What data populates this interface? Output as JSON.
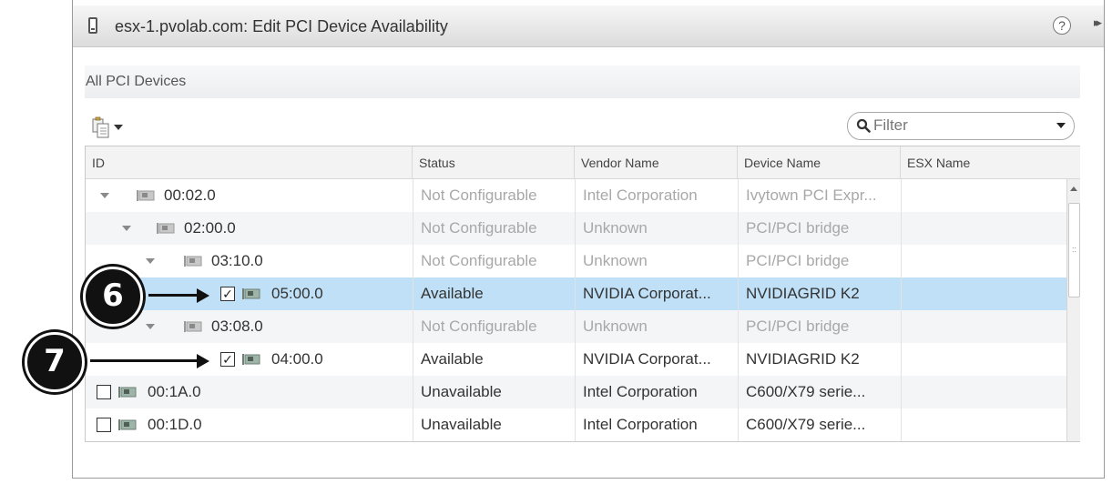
{
  "dialog": {
    "title": "esx-1.pvolab.com: Edit PCI Device Availability",
    "help_icon": "?",
    "expand_icon": "▸▸"
  },
  "section": {
    "title": "All PCI Devices"
  },
  "toolbar": {
    "export_icon": "copy-export-icon"
  },
  "filter": {
    "placeholder": "Filter"
  },
  "table": {
    "columns": [
      "ID",
      "Status",
      "Vendor Name",
      "Device Name",
      "ESX Name"
    ],
    "rows": [
      {
        "id": "00:02.0",
        "status": "Not Configurable",
        "vendor": "Intel Corporation",
        "device": "Ivytown PCI Expr...",
        "esx": "",
        "checked": null
      },
      {
        "id": "02:00.0",
        "status": "Not Configurable",
        "vendor": "Unknown",
        "device": "PCI/PCI bridge",
        "esx": "",
        "checked": null
      },
      {
        "id": "03:10.0",
        "status": "Not Configurable",
        "vendor": "Unknown",
        "device": "PCI/PCI bridge",
        "esx": "",
        "checked": null
      },
      {
        "id": "05:00.0",
        "status": "Available",
        "vendor": "NVIDIA Corporat...",
        "device": "NVIDIAGRID K2",
        "esx": "",
        "checked": true
      },
      {
        "id": "03:08.0",
        "status": "Not Configurable",
        "vendor": "Unknown",
        "device": "PCI/PCI bridge",
        "esx": "",
        "checked": null
      },
      {
        "id": "04:00.0",
        "status": "Available",
        "vendor": "NVIDIA Corporat...",
        "device": "NVIDIAGRID K2",
        "esx": "",
        "checked": true
      },
      {
        "id": "00:1A.0",
        "status": "Unavailable",
        "vendor": "Intel Corporation",
        "device": "C600/X79 serie...",
        "esx": "",
        "checked": false
      },
      {
        "id": "00:1D.0",
        "status": "Unavailable",
        "vendor": "Intel Corporation",
        "device": "C600/X79 serie...",
        "esx": "",
        "checked": false
      }
    ],
    "checkmark": "✓"
  },
  "callouts": {
    "six": "6",
    "seven": "7"
  }
}
